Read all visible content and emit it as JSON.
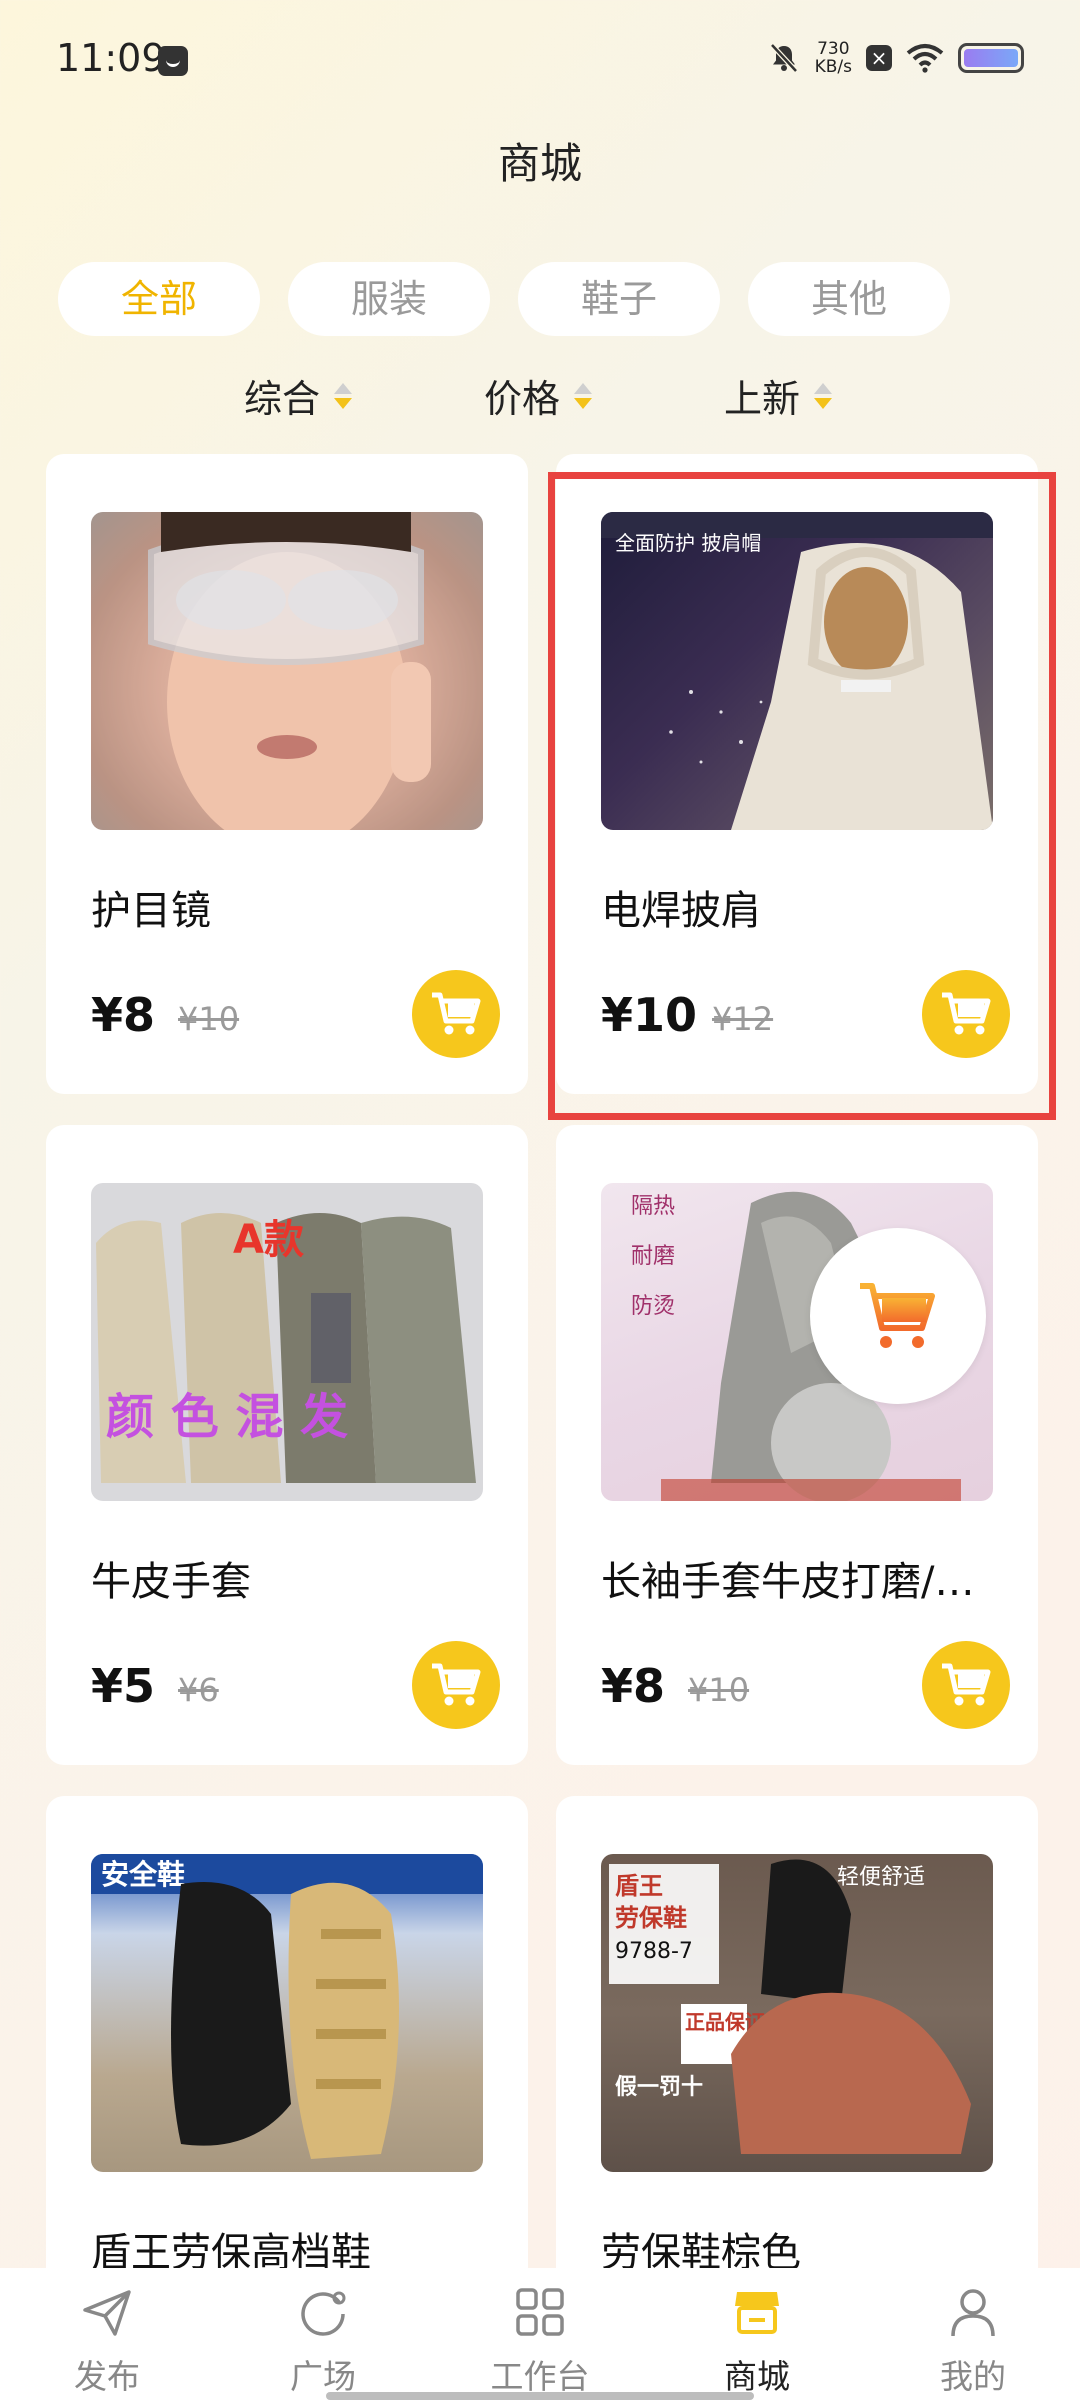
{
  "status_bar": {
    "time": "11:09",
    "network_speed_value": "730",
    "network_speed_unit": "KB/s"
  },
  "page_title": "商城",
  "tabs": [
    {
      "label": "全部",
      "active": true
    },
    {
      "label": "服装",
      "active": false
    },
    {
      "label": "鞋子",
      "active": false
    },
    {
      "label": "其他",
      "active": false
    }
  ],
  "sort_options": [
    {
      "label": "综合"
    },
    {
      "label": "价格"
    },
    {
      "label": "上新"
    }
  ],
  "products": [
    {
      "name": "护目镜",
      "price": "¥8",
      "original_price": "¥10"
    },
    {
      "name": "电焊披肩",
      "price": "¥10",
      "original_price": "¥12",
      "image_text_1": "全面防护 披肩帽"
    },
    {
      "name": "牛皮手套",
      "price": "¥5",
      "original_price": "¥6",
      "image_text_1": "A款",
      "image_text_2": "颜 色 混 发"
    },
    {
      "name": "长袖手套牛皮打磨/…",
      "price": "¥8",
      "original_price": "¥10",
      "image_text_1": "隔热",
      "image_text_2": "耐磨",
      "image_text_3": "防烫"
    },
    {
      "name": "盾王劳保高档鞋",
      "image_text_1": "安全鞋"
    },
    {
      "name": "劳保鞋棕色",
      "image_text_1": "盾王",
      "image_text_2": "劳保鞋",
      "image_text_3": "9788-7",
      "image_text_4": "正品保证",
      "image_text_5": "假一罚十",
      "image_text_6": "轻便舒适"
    }
  ],
  "bottom_nav": [
    {
      "label": "发布",
      "icon": "paper-plane-icon",
      "active": false
    },
    {
      "label": "广场",
      "icon": "circle-refresh-icon",
      "active": false
    },
    {
      "label": "工作台",
      "icon": "grid-icon",
      "active": false
    },
    {
      "label": "商城",
      "icon": "store-icon",
      "active": true
    },
    {
      "label": "我的",
      "icon": "user-icon",
      "active": false
    }
  ],
  "colors": {
    "accent": "#f6c71c",
    "highlight_border": "#e8433f"
  }
}
